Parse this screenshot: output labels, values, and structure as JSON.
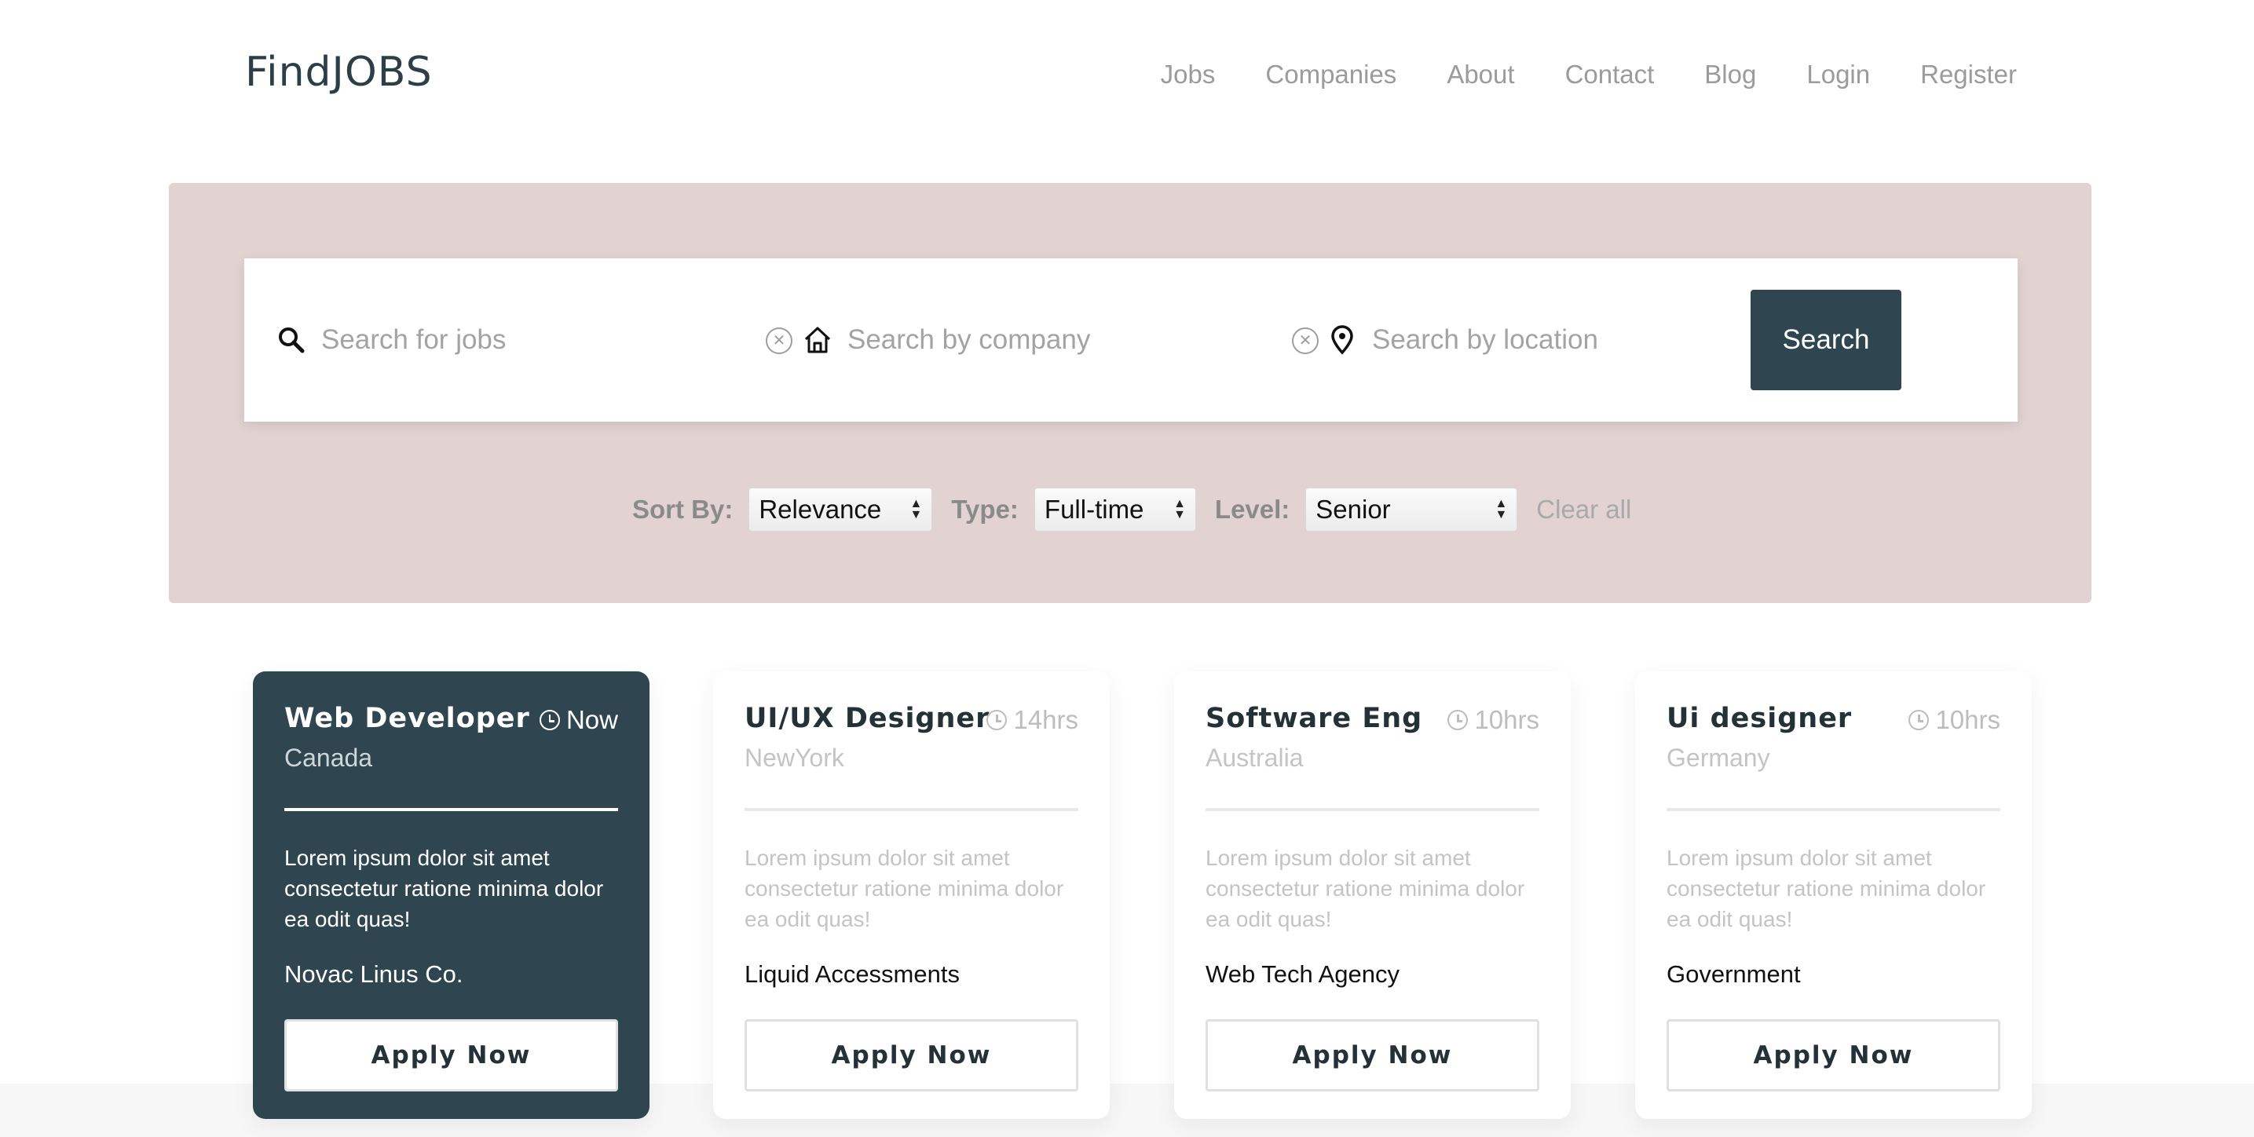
{
  "header": {
    "logo": "FindJOBS",
    "nav": [
      "Jobs",
      "Companies",
      "About",
      "Contact",
      "Blog",
      "Login",
      "Register"
    ]
  },
  "search": {
    "jobs_placeholder": "Search for jobs",
    "company_placeholder": "Search by company",
    "location_placeholder": "Search by location",
    "button_label": "Search",
    "clear_glyph": "✕"
  },
  "filters": {
    "sort_label": "Sort By:",
    "sort_value": "Relevance",
    "type_label": "Type:",
    "type_value": "Full-time",
    "level_label": "Level:",
    "level_value": "Senior",
    "clear_all": "Clear all"
  },
  "cards": [
    {
      "title": "Web Developer",
      "time": "Now",
      "location": "Canada",
      "description": "Lorem ipsum dolor sit amet consectetur ratione minima dolor ea odit quas!",
      "company": "Novac Linus Co.",
      "apply_label": "Apply Now"
    },
    {
      "title": "UI/UX Designer",
      "time": "14hrs",
      "location": "NewYork",
      "description": "Lorem ipsum dolor sit amet consectetur ratione minima dolor ea odit quas!",
      "company": "Liquid Accessments",
      "apply_label": "Apply Now"
    },
    {
      "title": "Software Eng",
      "time": "10hrs",
      "location": "Australia",
      "description": "Lorem ipsum dolor sit amet consectetur ratione minima dolor ea odit quas!",
      "company": "Web Tech Agency",
      "apply_label": "Apply Now"
    },
    {
      "title": "Ui designer",
      "time": "10hrs",
      "location": "Germany",
      "description": "Lorem ipsum dolor sit amet consectetur ratione minima dolor ea odit quas!",
      "company": "Government",
      "apply_label": "Apply Now"
    }
  ],
  "colors": {
    "primary": "#2f4650",
    "hero_bg": "#e2d2d2",
    "muted_text": "#9b9b9b"
  }
}
